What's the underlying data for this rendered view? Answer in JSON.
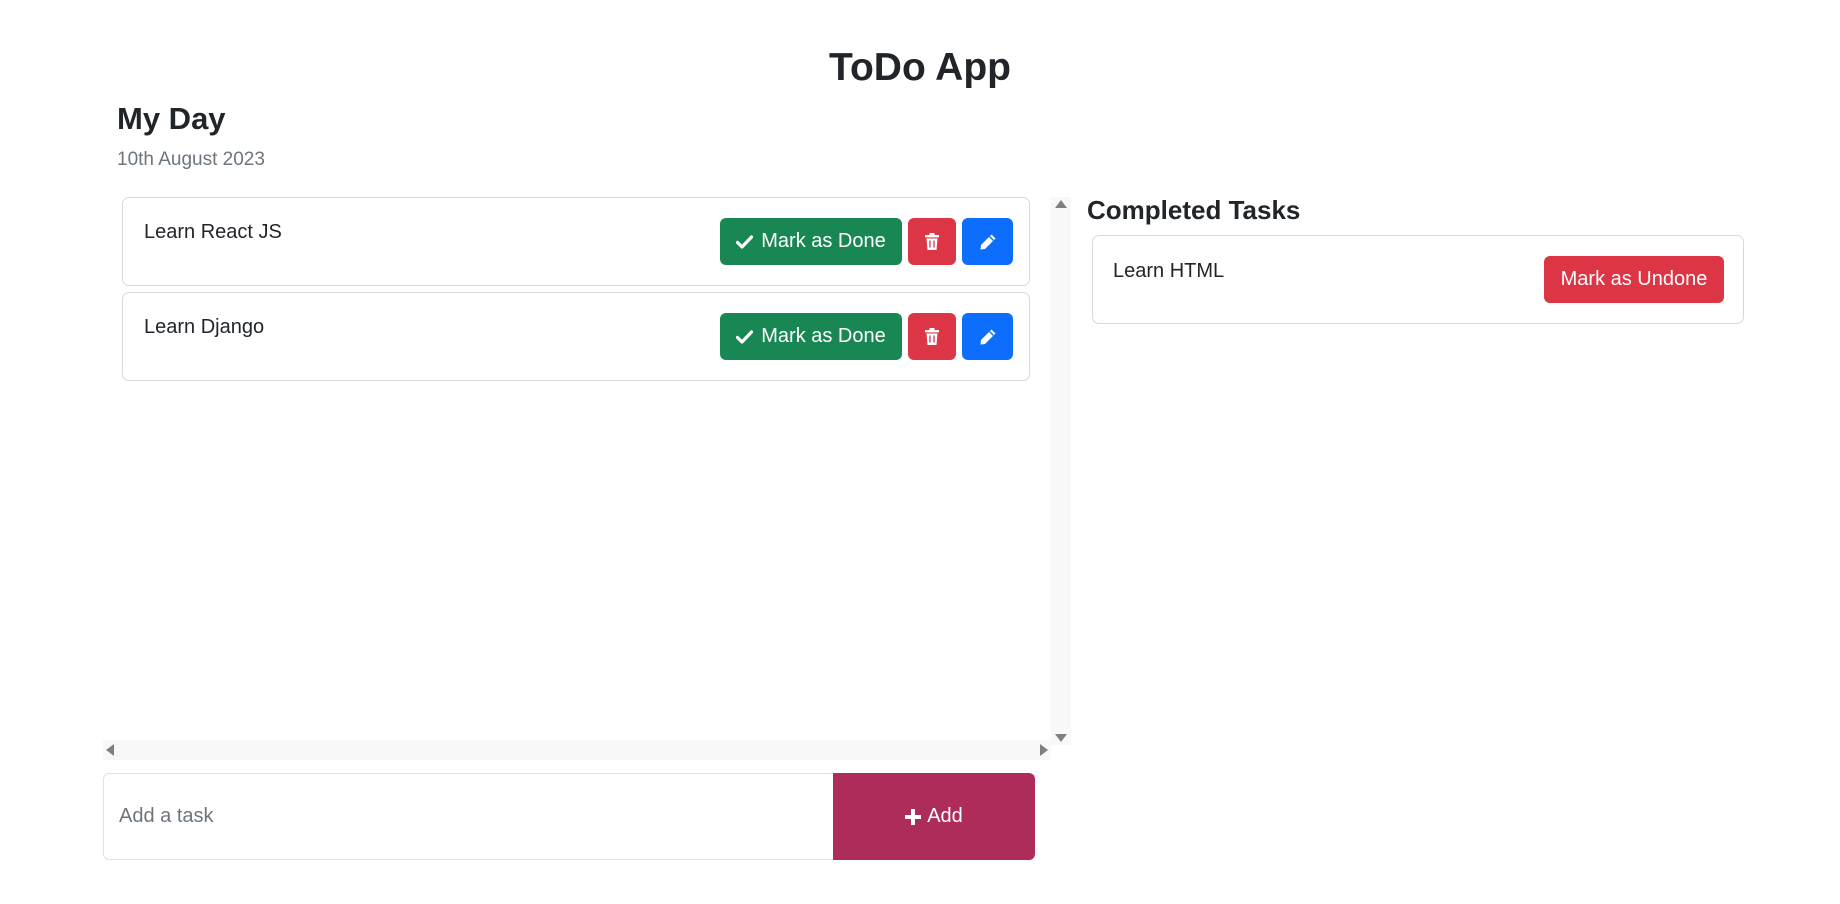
{
  "app": {
    "title": "ToDo App"
  },
  "day": {
    "title": "My Day",
    "date": "10th August 2023"
  },
  "tasks": [
    {
      "text": "Learn React JS",
      "done_label": "Mark as Done",
      "delete_icon": "trash-icon",
      "edit_icon": "pencil-icon"
    },
    {
      "text": "Learn Django",
      "done_label": "Mark as Done",
      "delete_icon": "trash-icon",
      "edit_icon": "pencil-icon"
    }
  ],
  "completed": {
    "title": "Completed Tasks",
    "tasks": [
      {
        "text": "Learn HTML",
        "undone_label": "Mark as Undone"
      }
    ]
  },
  "add": {
    "placeholder": "Add a task",
    "value": "",
    "button_label": "Add",
    "button_icon": "plus-icon"
  },
  "colors": {
    "done": "#198754",
    "delete": "#dc3545",
    "edit": "#0d6efd",
    "undone": "#dc3545",
    "add": "#ae2c5c"
  }
}
